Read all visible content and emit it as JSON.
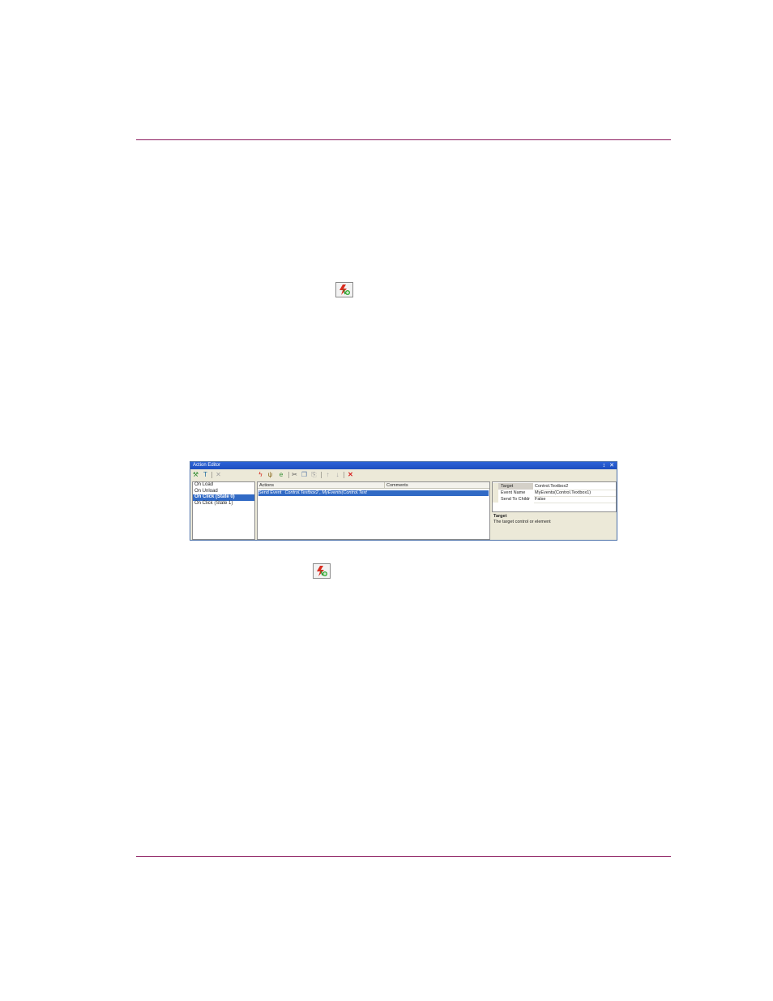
{
  "colors": {
    "rule": "#8b1a5e",
    "titlebar": "#2b62d8",
    "selection": "#316ac5"
  },
  "action_editor": {
    "title": "Action Editor",
    "window_controls": {
      "pin": "%",
      "close": "×"
    },
    "events": [
      "On Load",
      "On Unload",
      "On Click (State 0)",
      "On Click (State 1)"
    ],
    "selected_event": "On Click (State 0)",
    "columns": {
      "actions": "Actions",
      "comments": "Comments"
    },
    "action_row": {
      "name": "Send Event",
      "params": "Control.Textbox2 , MyEvents(Control.Text"
    },
    "properties": [
      {
        "key": "Target",
        "value": "Control.Textbox2"
      },
      {
        "key": "Event Name",
        "value": "MyEvents(Control.Textbox1)"
      },
      {
        "key": "Send To Childr",
        "value": "False"
      }
    ],
    "description": {
      "title": "Target",
      "text": "The target control or element"
    }
  },
  "icons": {
    "inline_1": "add-action-icon",
    "inline_2": "add-action-icon"
  }
}
